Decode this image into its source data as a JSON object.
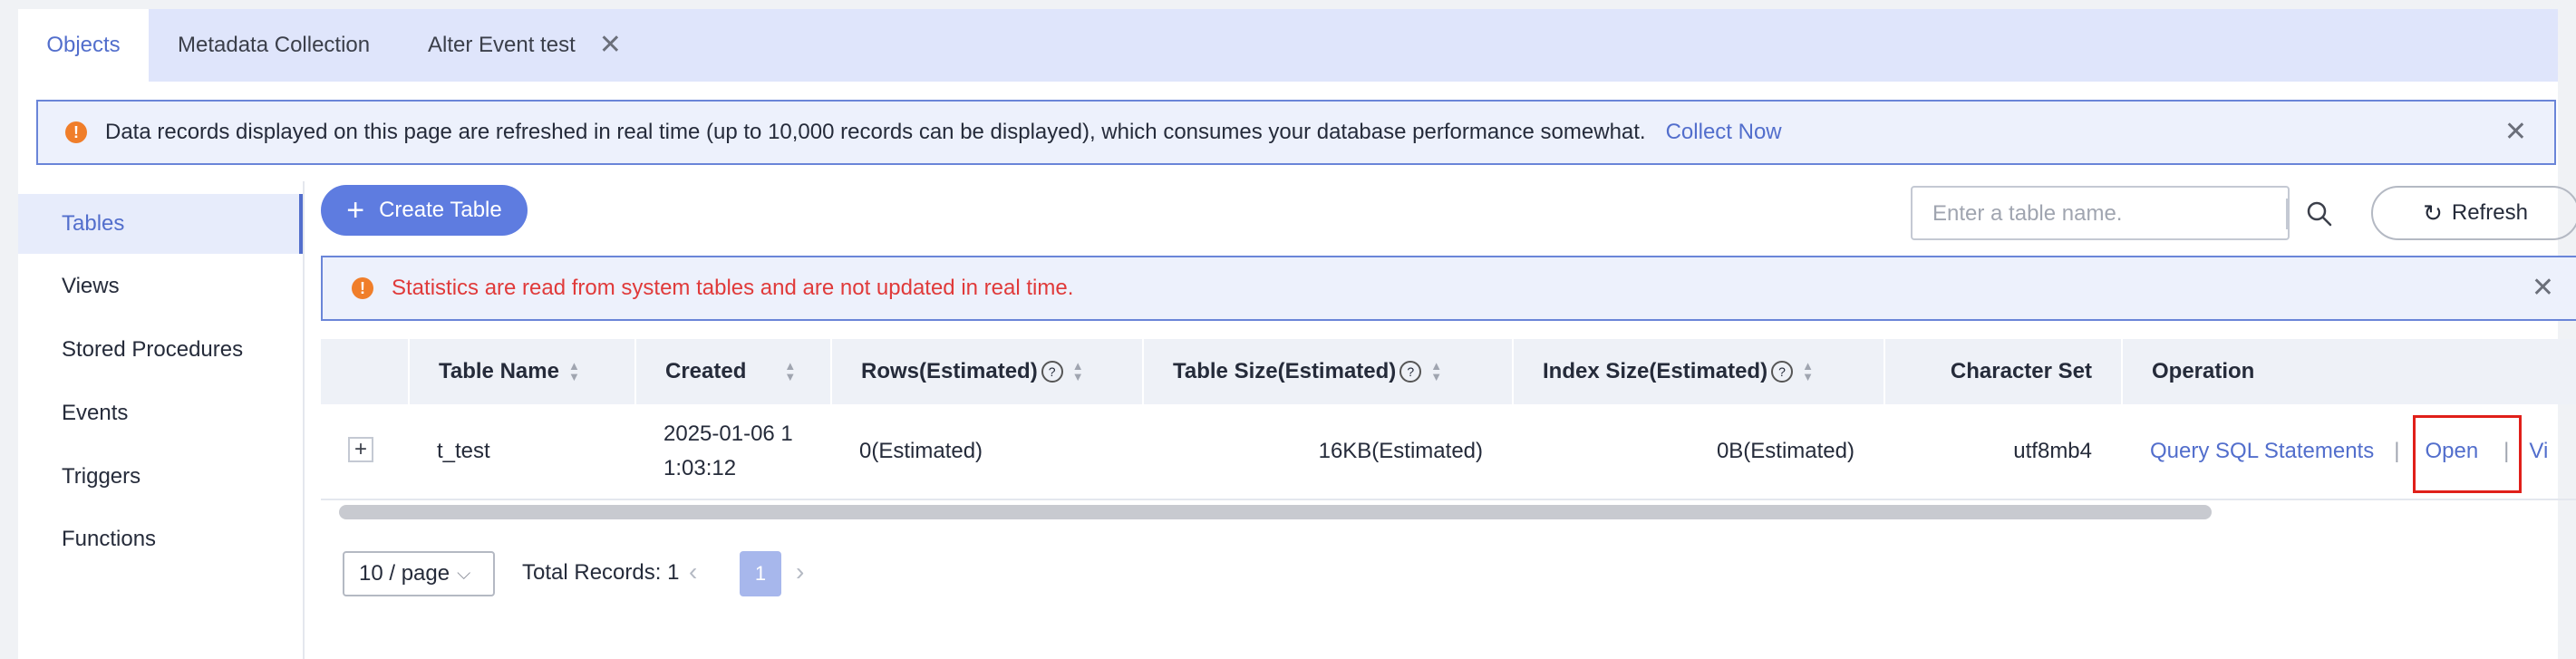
{
  "tabs": [
    {
      "label": "Objects",
      "active": true
    },
    {
      "label": "Metadata Collection",
      "active": false
    },
    {
      "label": "Alter Event test",
      "active": false,
      "closable": true
    }
  ],
  "top_banner": {
    "text": "Data records displayed on this page are refreshed in real time (up to 10,000 records can be displayed), which consumes your database performance somewhat.",
    "link": "Collect Now"
  },
  "sidebar": {
    "items": [
      {
        "label": "Tables",
        "active": true
      },
      {
        "label": "Views"
      },
      {
        "label": "Stored Procedures"
      },
      {
        "label": "Events"
      },
      {
        "label": "Triggers"
      },
      {
        "label": "Functions"
      }
    ]
  },
  "toolbar": {
    "create_label": "Create Table",
    "search_placeholder": "Enter a table name.",
    "refresh_label": "Refresh"
  },
  "stats_banner": {
    "text": "Statistics are read from system tables and are not updated in real time."
  },
  "table": {
    "columns": [
      "Table Name",
      "Created",
      "Rows(Estimated)",
      "Table Size(Estimated)",
      "Index Size(Estimated)",
      "Character Set",
      "Operation"
    ],
    "rows": [
      {
        "table_name": "t_test",
        "created_line1": "2025-01-06 1",
        "created_line2": "1:03:12",
        "rows": "0(Estimated)",
        "table_size": "16KB(Estimated)",
        "index_size": "0B(Estimated)",
        "charset": "utf8mb4",
        "ops": [
          "Query SQL Statements",
          "Open",
          "Vi"
        ]
      }
    ]
  },
  "pagination": {
    "page_size": "10 / page",
    "total": "Total Records: 1",
    "current_page": "1"
  },
  "colors": {
    "accent": "#526ecc",
    "button": "#5e7ce0",
    "warning": "#f07e2a",
    "error_text": "#e03a3a",
    "highlight_box": "#e0201a"
  }
}
